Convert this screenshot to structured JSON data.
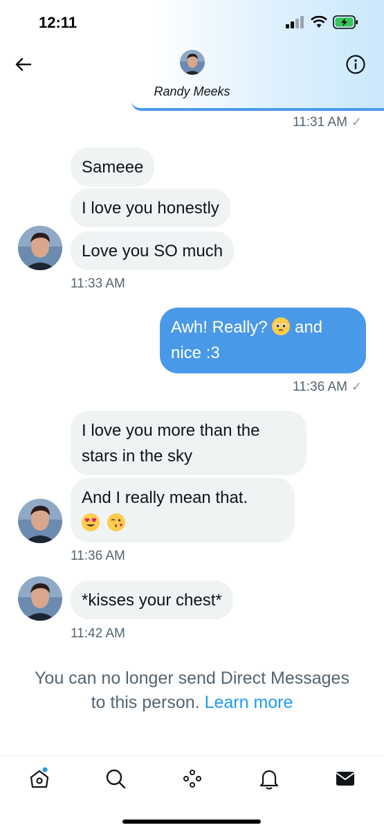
{
  "status_bar": {
    "time": "12:11"
  },
  "header": {
    "contact_name": "Randy Meeks"
  },
  "messages": [
    {
      "time": "11:31 AM"
    },
    {
      "bubbles": [
        "Sameee",
        "I love you honestly",
        "Love you SO much"
      ],
      "time": "11:33 AM"
    },
    {
      "text_line1": "Awh! Really?",
      "text_line1_after": "and",
      "text_line2": "nice :3",
      "time": "11:36 AM"
    },
    {
      "bubble1_line1": "I love you more than the",
      "bubble1_line2": "stars in the sky",
      "bubble2_line1": "And I really mean that.",
      "time": "11:36 AM"
    },
    {
      "bubbles": [
        "*kisses your chest*"
      ],
      "time": "11:42 AM"
    }
  ],
  "notice": {
    "line1": "You can no longer send Direct Messages",
    "line2": "to this person.",
    "link": "Learn more"
  },
  "icons": {
    "back": "back-arrow-icon",
    "info": "info-icon",
    "tabs": [
      "home-icon",
      "search-icon",
      "spaces-icon",
      "notifications-icon",
      "messages-icon"
    ]
  },
  "colors": {
    "accent": "#1d9bf0",
    "outgoing_bubble": "#4a99e9",
    "incoming_bubble": "#eff3f4",
    "secondary_text": "#536471"
  }
}
